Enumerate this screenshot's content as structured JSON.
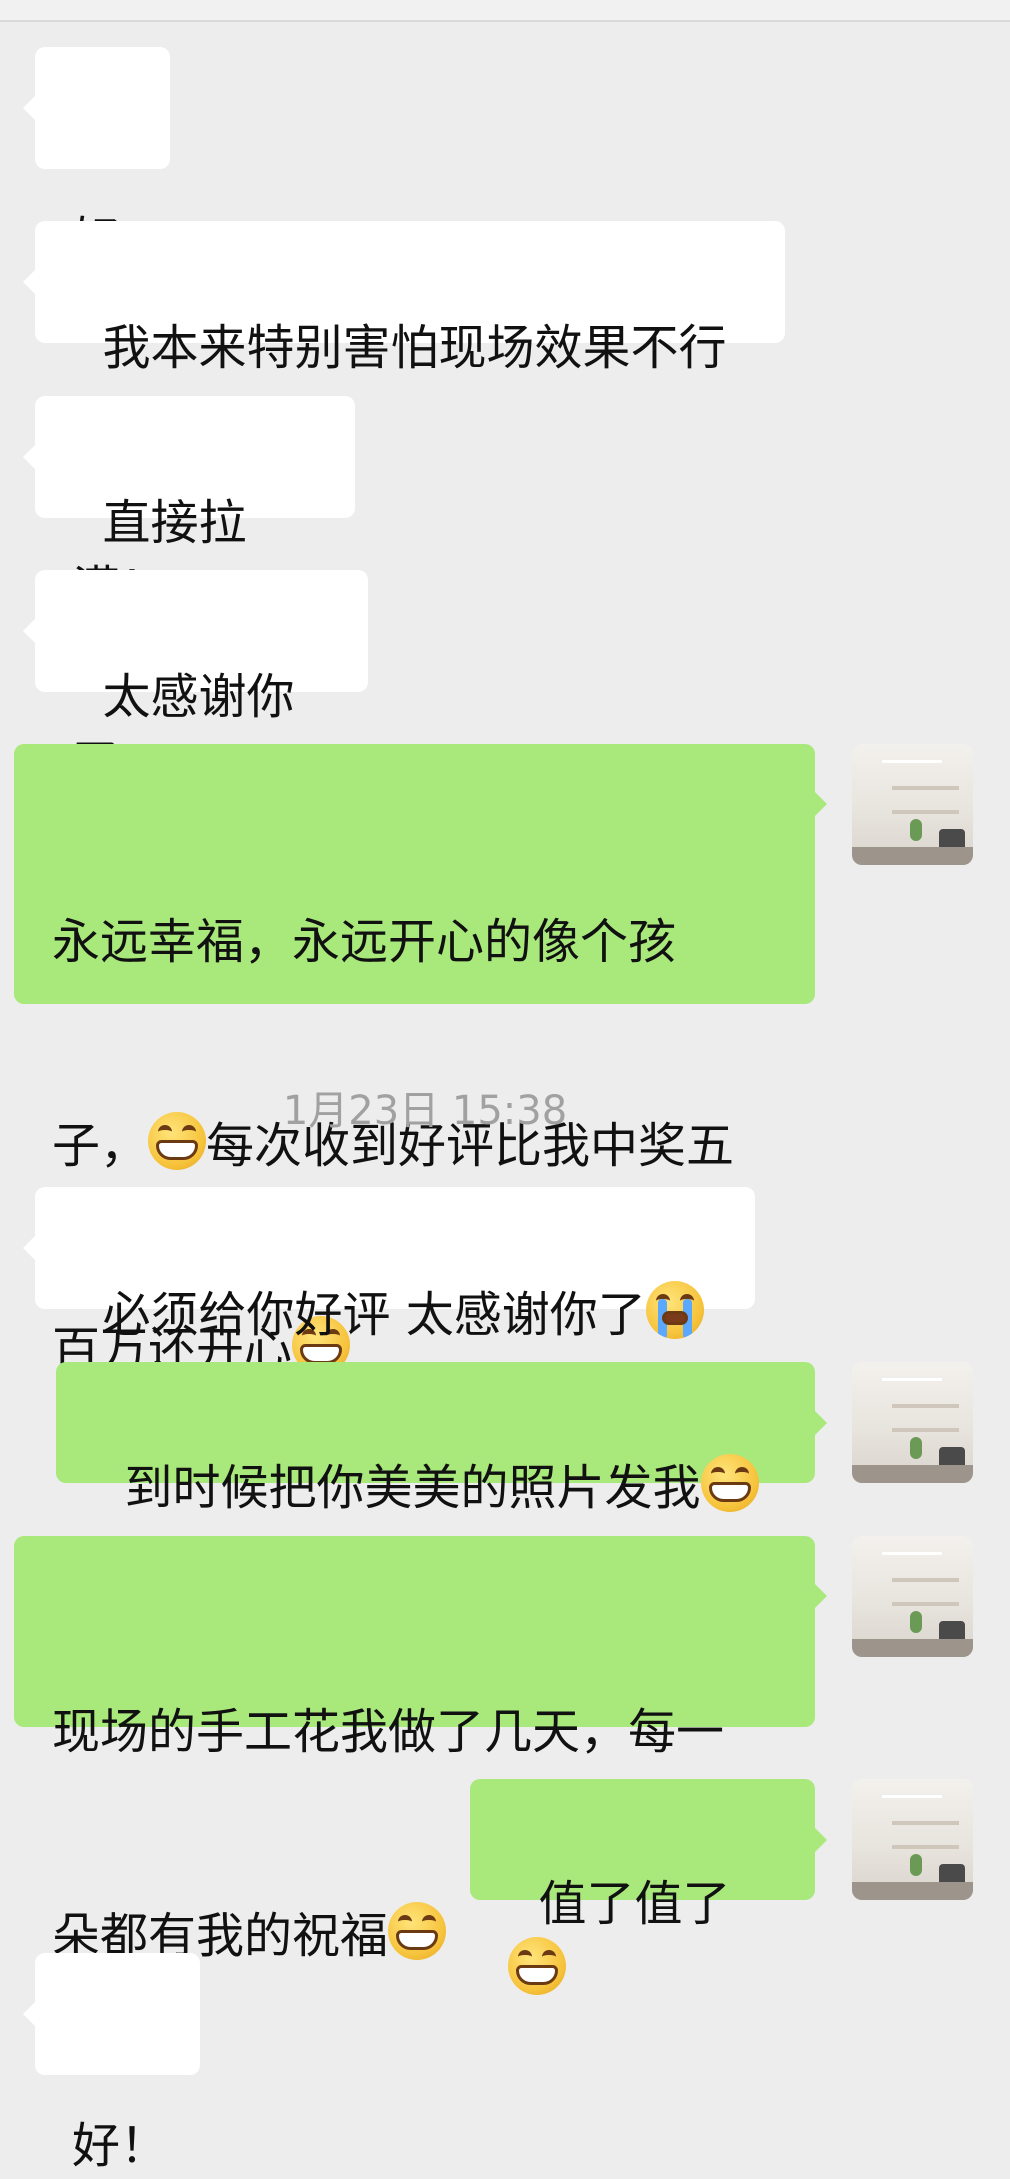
{
  "messages": [
    {
      "text": "好"
    },
    {
      "text": "我本来特别害怕现场效果不行"
    },
    {
      "text": "直接拉满！"
    },
    {
      "text": "太感谢你了"
    },
    {
      "line1": "永远幸福，永远开心的像个孩",
      "line2a": "子，",
      "line2b": "每次收到好评比我中奖五",
      "line3": "百万还开心"
    },
    {
      "text": "必须给你好评 太感谢你了"
    },
    {
      "text": "到时候把你美美的照片发我"
    },
    {
      "line1": "现场的手工花我做了几天，每一",
      "line2": "朵都有我的祝福"
    },
    {
      "text": "值了值了"
    },
    {
      "text": "好！"
    }
  ],
  "timestamp": "1月23日 15:38",
  "icons": {
    "grin": "grinning-face-emoji",
    "cry": "loudly-crying-face-emoji"
  }
}
